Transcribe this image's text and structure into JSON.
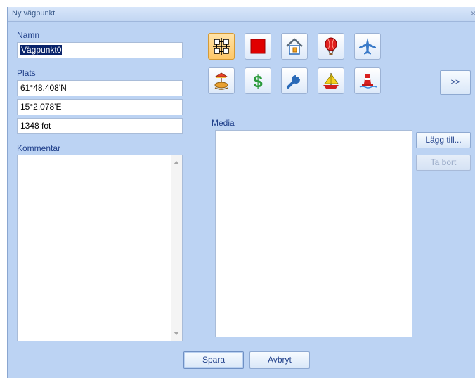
{
  "window": {
    "title": "Ny vägpunkt",
    "close_glyph": "×"
  },
  "name": {
    "label": "Namn",
    "value": "Vägpunkt0"
  },
  "location": {
    "label": "Plats",
    "latitude": "61°48.408'N",
    "longitude": "15°2.078'E",
    "altitude": "1348 fot"
  },
  "comment": {
    "label": "Kommentar",
    "value": ""
  },
  "icons": [
    {
      "name": "waypoint-icon",
      "selected": true
    },
    {
      "name": "red-square-icon",
      "selected": false
    },
    {
      "name": "house-icon",
      "selected": false
    },
    {
      "name": "hot-air-balloon-icon",
      "selected": false
    },
    {
      "name": "airplane-icon",
      "selected": false
    },
    {
      "name": "amusement-park-icon",
      "selected": false
    },
    {
      "name": "dollar-icon",
      "selected": false
    },
    {
      "name": "wrench-icon",
      "selected": false
    },
    {
      "name": "sailboat-icon",
      "selected": false
    },
    {
      "name": "buoy-icon",
      "selected": false
    }
  ],
  "more_icons_label": ">>",
  "media": {
    "label": "Media",
    "add_label": "Lägg till...",
    "remove_label": "Ta bort"
  },
  "footer": {
    "save_label": "Spara",
    "cancel_label": "Avbryt"
  },
  "colors": {
    "dialog_bg": "#bcd3f3",
    "label": "#1f3f8a",
    "selection": "#0a246a",
    "selected_icon_bg": "#ffc767"
  }
}
